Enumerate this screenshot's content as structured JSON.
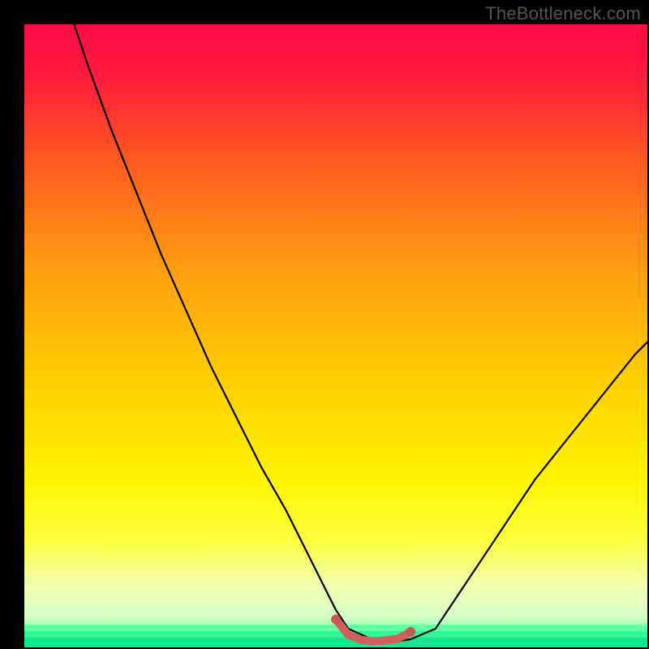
{
  "watermark": "TheBottleneck.com",
  "colors": {
    "black": "#000000",
    "watermark": "#555555",
    "gradient_stops": [
      {
        "pos": 0.0,
        "color": "#ff0b48"
      },
      {
        "pos": 0.08,
        "color": "#ff1a3c"
      },
      {
        "pos": 0.22,
        "color": "#ff5a20"
      },
      {
        "pos": 0.4,
        "color": "#ffa010"
      },
      {
        "pos": 0.58,
        "color": "#ffd000"
      },
      {
        "pos": 0.73,
        "color": "#fff300"
      },
      {
        "pos": 0.83,
        "color": "#fcff40"
      },
      {
        "pos": 0.9,
        "color": "#f2ffb0"
      },
      {
        "pos": 0.95,
        "color": "#d6ffc6"
      },
      {
        "pos": 0.985,
        "color": "#64ffa0"
      },
      {
        "pos": 1.0,
        "color": "#1dff90"
      }
    ],
    "curve_stroke": "#000000",
    "accent_stroke": "#d0605e",
    "accent_stroke_dark": "#c85754"
  },
  "chart_data": {
    "type": "line",
    "title": "",
    "xlabel": "",
    "ylabel": "",
    "xlim": [
      0,
      100
    ],
    "ylim": [
      0,
      100
    ],
    "legend": false,
    "grid": false,
    "axes_visible": false,
    "note": "Values estimated from pixels; no axes/ticks visible in source image.",
    "series": [
      {
        "name": "main-curve",
        "stroke": "#000000",
        "x": [
          8,
          10,
          14,
          18,
          22,
          26,
          30,
          34,
          38,
          42,
          46,
          48,
          50,
          52,
          56,
          60,
          62,
          66,
          70,
          74,
          78,
          82,
          86,
          90,
          94,
          98,
          100
        ],
        "y": [
          100,
          94,
          83,
          73,
          63,
          54,
          45,
          37,
          29,
          22,
          14,
          10,
          6,
          3,
          1.2,
          1.0,
          1.3,
          3,
          9,
          15,
          21,
          27,
          32,
          37,
          42,
          47,
          49
        ]
      },
      {
        "name": "bottom-accent-segment",
        "stroke": "#d0605e",
        "x": [
          50,
          52,
          54,
          56,
          58,
          60,
          62
        ],
        "y": [
          4.5,
          2.0,
          1.2,
          1.0,
          1.1,
          1.4,
          2.5
        ]
      }
    ],
    "bottom_bands": [
      {
        "from_y": 2.6,
        "to_y": 3.6,
        "color": "#64ffa0"
      },
      {
        "from_y": 1.6,
        "to_y": 2.6,
        "color": "#32f59a"
      },
      {
        "from_y": 0.0,
        "to_y": 1.6,
        "color": "#18e68f"
      }
    ]
  }
}
